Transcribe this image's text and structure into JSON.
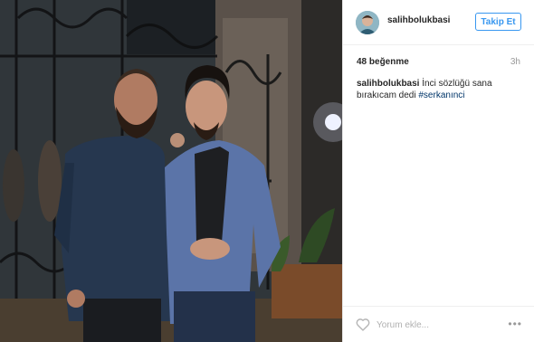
{
  "post": {
    "image_alt": "Two men posing at night in front of an ornate iron gate",
    "header": {
      "username": "salihbolukbasi",
      "follow_label": "Takip Et"
    },
    "likes_text": "48 beğenme",
    "time_ago": "3h",
    "caption": {
      "username": "salihbolukbasi",
      "text": " İnci sözlüğü sana bırakıcam dedi ",
      "hashtag": "#serkanınci"
    },
    "comment": {
      "placeholder": "Yorum ekle...",
      "value": ""
    },
    "more_label": "•••"
  },
  "colors": {
    "accent": "#3897f0",
    "hashtag": "#003569",
    "muted": "#999999"
  },
  "icons": {
    "like": "heart-outline-icon",
    "more": "ellipsis-icon"
  }
}
